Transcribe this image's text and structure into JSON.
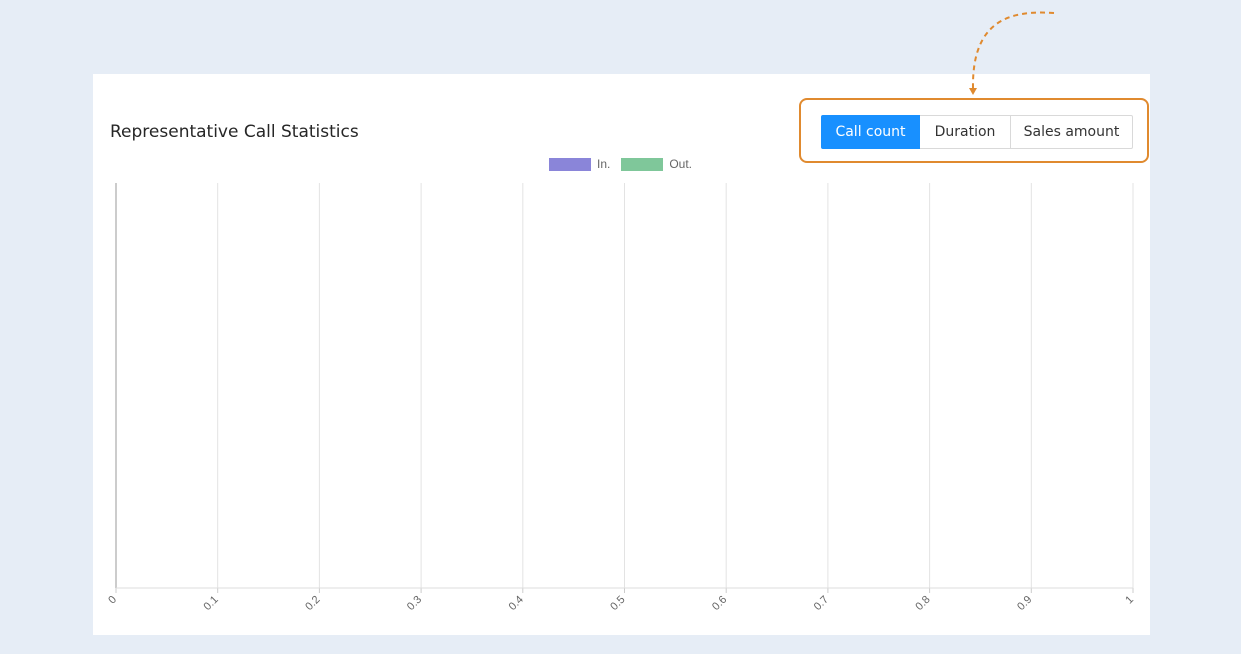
{
  "chart_title": "Representative Call Statistics",
  "metric_buttons": [
    {
      "label": "Call count",
      "active": true
    },
    {
      "label": "Duration",
      "active": false
    },
    {
      "label": "Sales amount",
      "active": false
    }
  ],
  "colors": {
    "background": "#e6edf6",
    "accent": "#1890ff",
    "highlight": "#e08a2f",
    "series_in": "#8a85d9",
    "series_out": "#7fc79a"
  },
  "chart_data": {
    "type": "bar",
    "orientation": "horizontal",
    "title": "Representative Call Statistics",
    "series": [
      {
        "name": "In.",
        "values": []
      },
      {
        "name": "Out.",
        "values": []
      }
    ],
    "categories": [],
    "xlim": [
      0,
      1
    ],
    "x_ticks": [
      "0",
      "0.1",
      "0.2",
      "0.3",
      "0.4",
      "0.5",
      "0.6",
      "0.7",
      "0.8",
      "0.9",
      "1"
    ],
    "grid": true,
    "legend": "top-center"
  }
}
